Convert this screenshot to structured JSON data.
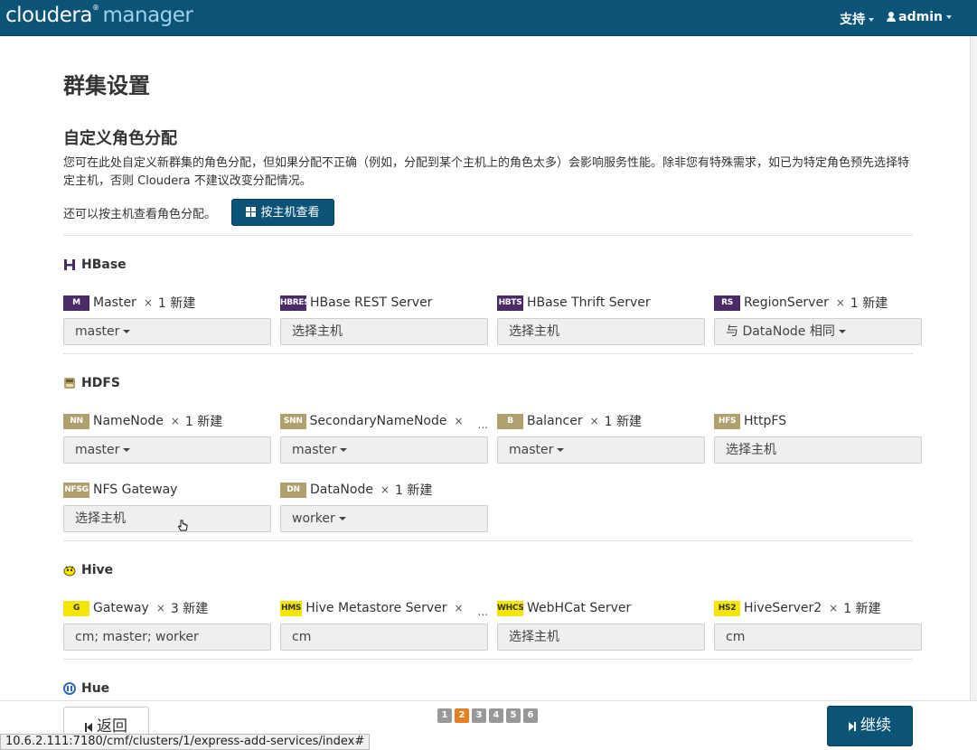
{
  "header": {
    "logo_main": "cloudera",
    "logo_reg": "®",
    "logo_sub": "manager",
    "support_label": "支持",
    "user_label": "admin"
  },
  "page": {
    "title": "群集设置",
    "section_title": "自定义角色分配",
    "description": "您可在此处自定义新群集的角色分配，但如果分配不正确（例如，分配到某个主机上的角色太多）会影响服务性能。除非您有特殊需求，如已为特定角色预先选择特定主机，否则 Cloudera 不建议改变分配情况。",
    "hostview_text": "还可以按主机查看角色分配。",
    "hostview_button": "按主机查看"
  },
  "services": {
    "hbase": {
      "name": "HBase",
      "roles": [
        {
          "badge": "M",
          "name": "Master",
          "times": "×",
          "count": "1 新建",
          "host": "master"
        },
        {
          "badge": "HBREST",
          "name": "HBase REST Server",
          "host": "选择主机"
        },
        {
          "badge": "HBTS",
          "name": "HBase Thrift Server",
          "host": "选择主机"
        },
        {
          "badge": "RS",
          "name": "RegionServer",
          "times": "×",
          "count": "1 新建",
          "host": "与 DataNode 相同"
        }
      ]
    },
    "hdfs": {
      "name": "HDFS",
      "roles": [
        {
          "badge": "NN",
          "name": "NameNode",
          "times": "×",
          "count": "1 新建",
          "host": "master"
        },
        {
          "badge": "SNN",
          "name": "SecondaryNameNode",
          "times": "×",
          "ellipsis": "...",
          "host": "master"
        },
        {
          "badge": "B",
          "name": "Balancer",
          "times": "×",
          "count": "1 新建",
          "host": "master"
        },
        {
          "badge": "HFS",
          "name": "HttpFS",
          "host": "选择主机"
        },
        {
          "badge": "NFSG",
          "name": "NFS Gateway",
          "host": "选择主机"
        },
        {
          "badge": "DN",
          "name": "DataNode",
          "times": "×",
          "count": "1 新建",
          "host": "worker"
        }
      ]
    },
    "hive": {
      "name": "Hive",
      "roles": [
        {
          "badge": "G",
          "name": "Gateway",
          "times": "×",
          "count": "3 新建",
          "host": "cm; master; worker"
        },
        {
          "badge": "HMS",
          "name": "Hive Metastore Server",
          "times": "×",
          "ellipsis": "...",
          "host": "cm"
        },
        {
          "badge": "WHCS",
          "name": "WebHCat Server",
          "host": "选择主机"
        },
        {
          "badge": "HS2",
          "name": "HiveServer2",
          "times": "×",
          "count": "1 新建",
          "host": "cm"
        }
      ]
    },
    "hue": {
      "name": "Hue"
    }
  },
  "footer": {
    "back_label": "返回",
    "next_label": "继续",
    "pages": [
      "1",
      "2",
      "3",
      "4",
      "5",
      "6"
    ],
    "active_page": 2
  },
  "statusbar": {
    "url": "10.6.2.111:7180/cmf/clusters/1/express-add-services/index#"
  },
  "colors": {
    "topbar": "#0b5478",
    "hbase_badge": "#4b2a68",
    "hdfs_badge": "#b0a070",
    "hive_badge": "#f4e600",
    "active_page": "#e67e22"
  }
}
